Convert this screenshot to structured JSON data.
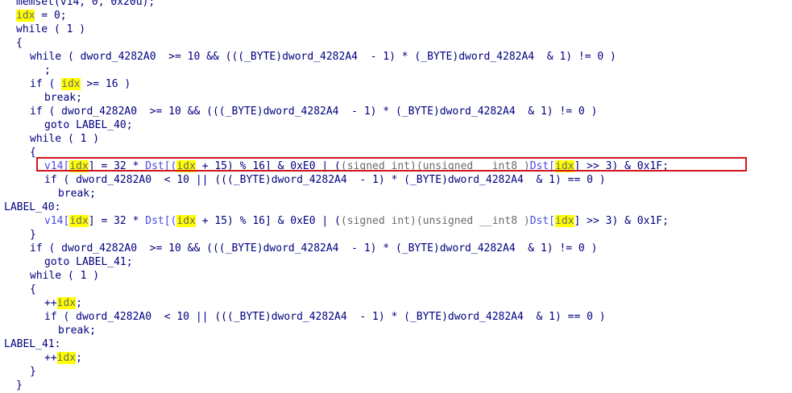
{
  "lines": [
    {
      "indent": "  ",
      "text": "memset(v14, 0, 0x20u);"
    },
    {
      "indent": "  ",
      "pre": "",
      "var": "idx",
      "post": " = 0;"
    },
    {
      "indent": "  ",
      "text": "while ( 1 )"
    },
    {
      "indent": "  ",
      "text": "{"
    },
    {
      "indent": "    ",
      "text": "while ( dword_4282A0  >= 10 && (((_BYTE)dword_4282A4  - 1) * (_BYTE)dword_4282A4  & 1) != 0 )"
    },
    {
      "indent": "      ",
      "text": ";"
    },
    {
      "indent": "    ",
      "pre": "if ( ",
      "var": "idx",
      "post": " >= 16 )"
    },
    {
      "indent": "      ",
      "text": "break;"
    },
    {
      "indent": "    ",
      "text": "if ( dword_4282A0  >= 10 && (((_BYTE)dword_4282A4  - 1) * (_BYTE)dword_4282A4  & 1) != 0 )"
    },
    {
      "indent": "      ",
      "text": "goto LABEL_40;"
    },
    {
      "indent": "    ",
      "text": "while ( 1 )"
    },
    {
      "indent": "    ",
      "text": "{"
    },
    {
      "indent": "      ",
      "assign": true
    },
    {
      "indent": "      ",
      "text": "if ( dword_4282A0  < 10 || (((_BYTE)dword_4282A4  - 1) * (_BYTE)dword_4282A4  & 1) == 0 )"
    },
    {
      "indent": "        ",
      "text": "break;"
    },
    {
      "indent": "",
      "text": "LABEL_40:"
    },
    {
      "indent": "      ",
      "assign": true
    },
    {
      "indent": "    ",
      "text": "}"
    },
    {
      "indent": "    ",
      "text": "if ( dword_4282A0  >= 10 && (((_BYTE)dword_4282A4  - 1) * (_BYTE)dword_4282A4  & 1) != 0 )"
    },
    {
      "indent": "      ",
      "text": "goto LABEL_41;"
    },
    {
      "indent": "    ",
      "text": "while ( 1 )"
    },
    {
      "indent": "    ",
      "text": "{"
    },
    {
      "indent": "      ",
      "pre": "++",
      "var": "idx",
      "post": ";"
    },
    {
      "indent": "      ",
      "text": "if ( dword_4282A0  < 10 || (((_BYTE)dword_4282A4  - 1) * (_BYTE)dword_4282A4  & 1) == 0 )"
    },
    {
      "indent": "        ",
      "text": "break;"
    },
    {
      "indent": "",
      "text": "LABEL_41:"
    },
    {
      "indent": "      ",
      "pre": "++",
      "var": "idx",
      "post": ";"
    },
    {
      "indent": "    ",
      "text": "}"
    },
    {
      "indent": "  ",
      "text": "}"
    }
  ],
  "assign_parts": {
    "v14": "v14[",
    "idx": "idx",
    "mid1": "] = 32 * ",
    "dst": "Dst[(",
    "mid2": " + 15) % 16] & 0xE0 | (",
    "cast1": "(signed int)",
    "cast2": "(unsigned __int8 )",
    "dst2": "Dst[",
    "tail": "] >> 3) & 0x1F;"
  },
  "colors": {
    "code_text": "#000080",
    "highlight_bg": "#ffff00",
    "box_border": "#d2141c"
  }
}
